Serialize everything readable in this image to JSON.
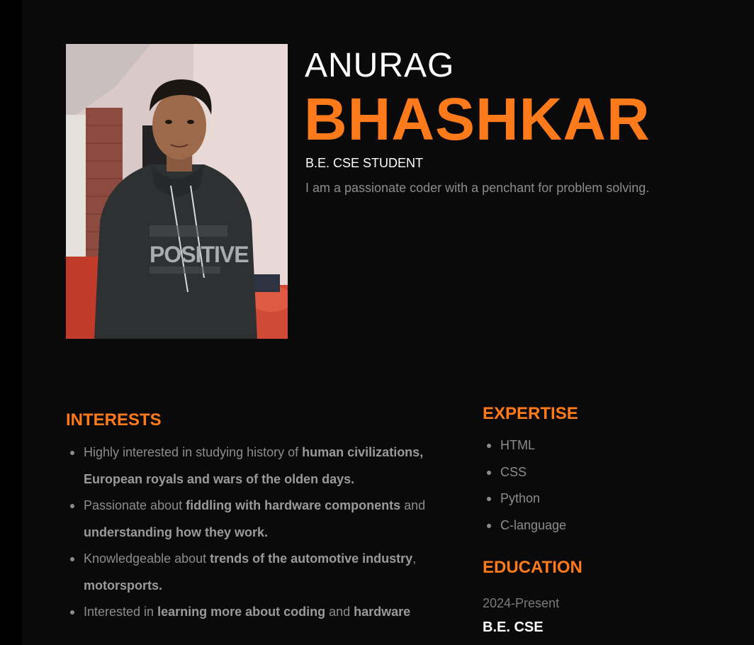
{
  "colors": {
    "accent": "#ff7a1a",
    "background": "#0a0a0b",
    "text_muted": "#8c8c8c",
    "text_primary": "#ffffff"
  },
  "profile": {
    "first_name": "ANURAG",
    "last_name": "BHASHKAR",
    "role": "B.E. CSE STUDENT",
    "tagline": "I am a passionate coder with a penchant for problem solving.",
    "photo_shirt_text": "POSITIVE"
  },
  "interests": {
    "title": "INTERESTS",
    "items": [
      {
        "parts": [
          {
            "text": "Highly interested in studying history of ",
            "bold": false
          },
          {
            "text": "human civilizations, European royals and wars of the olden days.",
            "bold": true
          }
        ]
      },
      {
        "parts": [
          {
            "text": "Passionate about ",
            "bold": false
          },
          {
            "text": "fiddling with hardware components",
            "bold": true
          },
          {
            "text": " and ",
            "bold": false
          },
          {
            "text": "understanding how they work.",
            "bold": true
          }
        ]
      },
      {
        "parts": [
          {
            "text": "Knowledgeable about ",
            "bold": false
          },
          {
            "text": "trends of the automotive industry",
            "bold": true
          },
          {
            "text": ", ",
            "bold": false
          },
          {
            "text": "motorsports.",
            "bold": true
          }
        ]
      },
      {
        "parts": [
          {
            "text": "Interested in ",
            "bold": false
          },
          {
            "text": "learning more about coding",
            "bold": true
          },
          {
            "text": " and ",
            "bold": false
          },
          {
            "text": "hardware",
            "bold": true
          }
        ]
      }
    ]
  },
  "expertise": {
    "title": "EXPERTISE",
    "items": [
      "HTML",
      "CSS",
      "Python",
      "C-language"
    ]
  },
  "education": {
    "title": "EDUCATION",
    "years": "2024-Present",
    "degree": "B.E. CSE"
  }
}
